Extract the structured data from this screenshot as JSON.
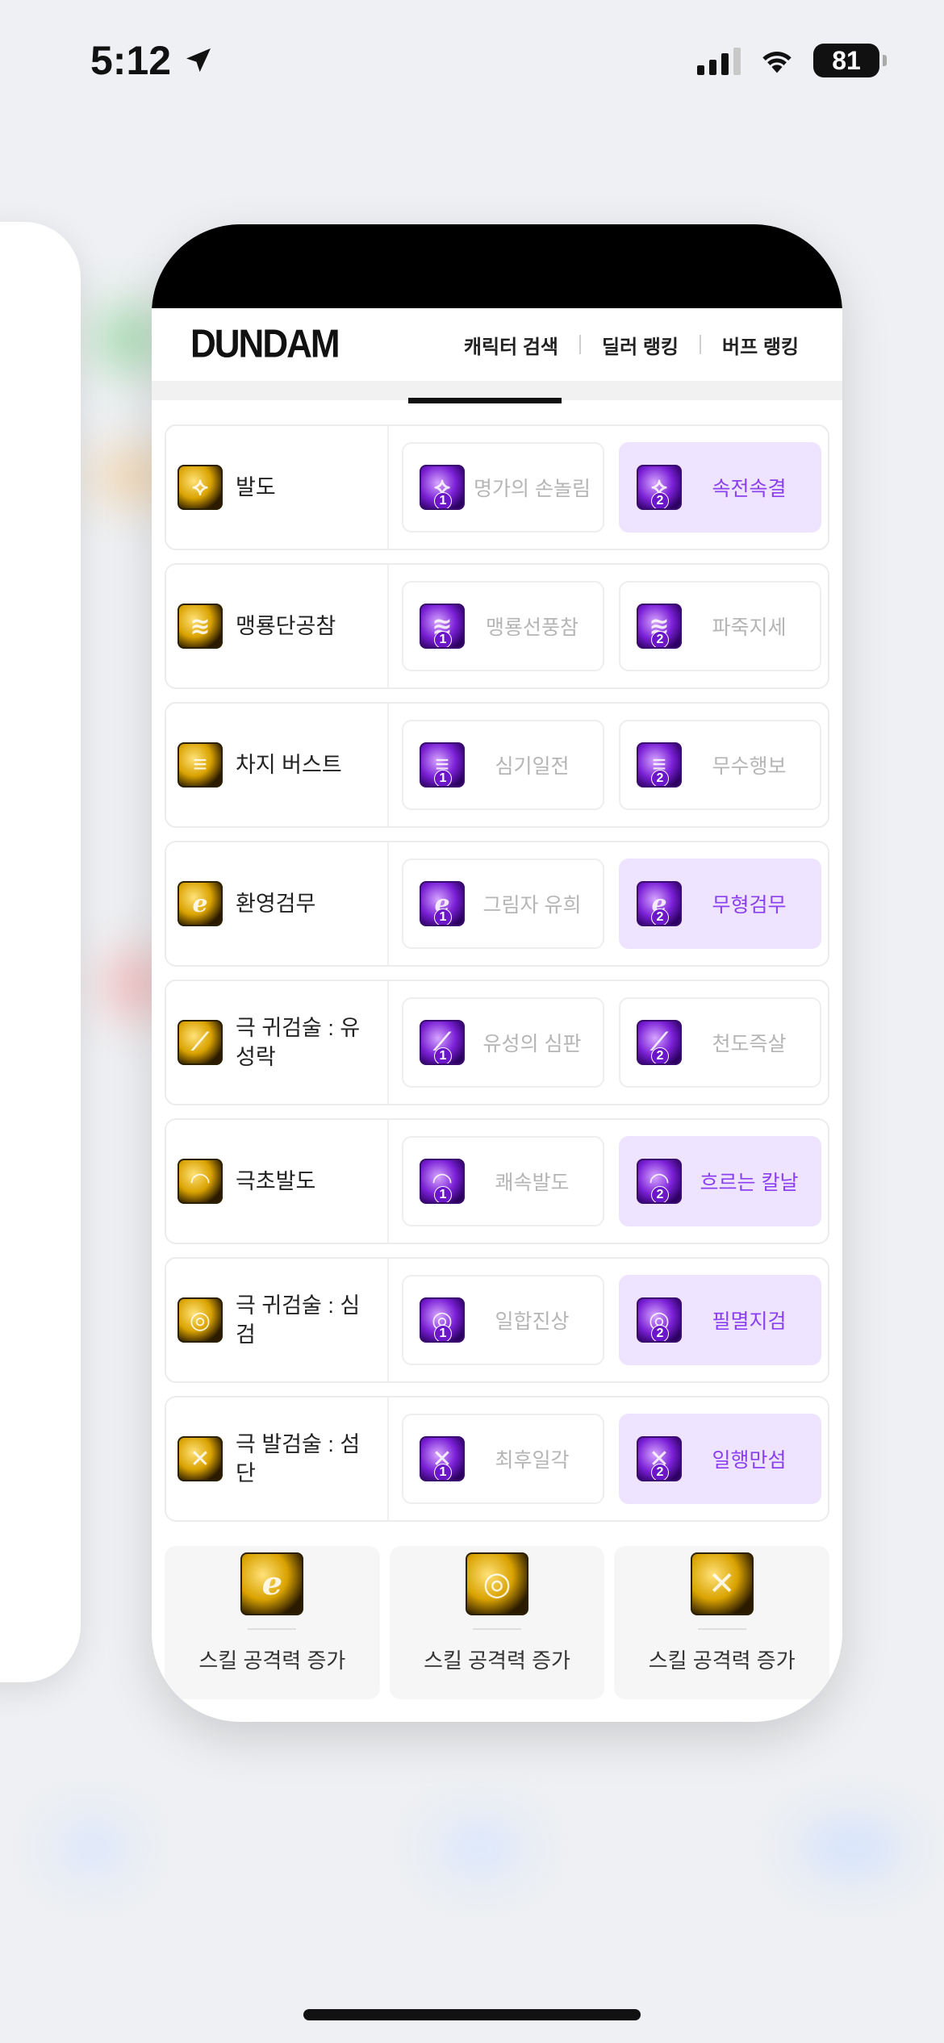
{
  "status_bar": {
    "time": "5:12",
    "battery": "81",
    "location_icon": "location-arrow-icon",
    "signal_icon": "cellular-signal-icon",
    "wifi_icon": "wifi-icon"
  },
  "app": {
    "logo": "DUNDAM",
    "nav": [
      "캐릭터 검색",
      "딜러 랭킹",
      "버프 랭킹"
    ]
  },
  "skills": [
    {
      "name": "발도",
      "icon": "gold",
      "glyph": "⟡",
      "options": [
        {
          "name": "명가의 손놀림",
          "badge": "1",
          "selected": false
        },
        {
          "name": "속전속결",
          "badge": "2",
          "selected": true
        }
      ]
    },
    {
      "name": "맹룡단공참",
      "icon": "gold",
      "glyph": "≋",
      "options": [
        {
          "name": "맹룡선풍참",
          "badge": "1",
          "selected": false
        },
        {
          "name": "파죽지세",
          "badge": "2",
          "selected": false
        }
      ]
    },
    {
      "name": "차지 버스트",
      "icon": "gold",
      "glyph": "≡",
      "options": [
        {
          "name": "심기일전",
          "badge": "1",
          "selected": false
        },
        {
          "name": "무수행보",
          "badge": "2",
          "selected": false
        }
      ]
    },
    {
      "name": "환영검무",
      "icon": "gold",
      "glyph": "ℯ",
      "options": [
        {
          "name": "그림자 유희",
          "badge": "1",
          "selected": false
        },
        {
          "name": "무형검무",
          "badge": "2",
          "selected": true
        }
      ]
    },
    {
      "name": "극 귀검술 : 유성락",
      "icon": "gold",
      "glyph": "⟋",
      "options": [
        {
          "name": "유성의 심판",
          "badge": "1",
          "selected": false
        },
        {
          "name": "천도즉살",
          "badge": "2",
          "selected": false
        }
      ]
    },
    {
      "name": "극초발도",
      "icon": "gold",
      "glyph": "◠",
      "options": [
        {
          "name": "쾌속발도",
          "badge": "1",
          "selected": false
        },
        {
          "name": "흐르는 칼날",
          "badge": "2",
          "selected": true
        }
      ]
    },
    {
      "name": "극 귀검술 : 심검",
      "icon": "gold",
      "glyph": "◎",
      "options": [
        {
          "name": "일합진상",
          "badge": "1",
          "selected": false
        },
        {
          "name": "필멸지검",
          "badge": "2",
          "selected": true
        }
      ]
    },
    {
      "name": "극 발검술 : 섬단",
      "icon": "gold",
      "glyph": "✕",
      "options": [
        {
          "name": "최후일각",
          "badge": "1",
          "selected": false
        },
        {
          "name": "일행만섬",
          "badge": "2",
          "selected": true
        }
      ]
    }
  ],
  "bottom": [
    {
      "label": "스킬 공격력 증가",
      "glyph": "ℯ"
    },
    {
      "label": "스킬 공격력 증가",
      "glyph": "◎"
    },
    {
      "label": "스킬 공격력 증가",
      "glyph": "✕"
    }
  ]
}
